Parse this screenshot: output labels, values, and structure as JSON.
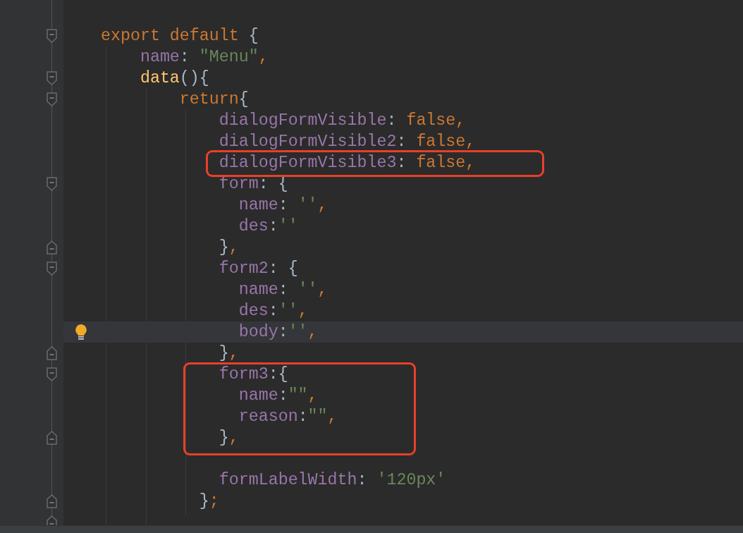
{
  "lines": [
    {
      "kind": "blank",
      "boxed": false
    },
    {
      "kind": "code",
      "boxed": false,
      "gutter": {
        "kind": "fold-start"
      },
      "tokens": [
        {
          "kind": "keyword",
          "text": "export default"
        },
        {
          "kind": "punct",
          "text": " {"
        }
      ]
    },
    {
      "kind": "code",
      "boxed": false,
      "tokens": [
        {
          "kind": "prop",
          "text": "    name"
        },
        {
          "kind": "punct",
          "text": ": "
        },
        {
          "kind": "string",
          "text": "\"Menu\""
        },
        {
          "kind": "keyword",
          "text": ","
        }
      ]
    },
    {
      "kind": "code",
      "boxed": false,
      "gutter": {
        "kind": "fold-start"
      },
      "tokens": [
        {
          "kind": "func",
          "text": "    data"
        },
        {
          "kind": "punct",
          "text": "(){"
        }
      ]
    },
    {
      "kind": "code",
      "boxed": false,
      "gutter": {
        "kind": "fold-start"
      },
      "tokens": [
        {
          "kind": "keyword",
          "text": "        return"
        },
        {
          "kind": "punct",
          "text": "{"
        }
      ]
    },
    {
      "kind": "code",
      "boxed": false,
      "tokens": [
        {
          "kind": "prop",
          "text": "            dialogFormVisible"
        },
        {
          "kind": "punct",
          "text": ": "
        },
        {
          "kind": "keyword",
          "text": "false,"
        }
      ]
    },
    {
      "kind": "code",
      "boxed": false,
      "tokens": [
        {
          "kind": "prop",
          "text": "            dialogFormVisible2"
        },
        {
          "kind": "punct",
          "text": ": "
        },
        {
          "kind": "keyword",
          "text": "false,"
        }
      ]
    },
    {
      "kind": "code",
      "boxed": true,
      "tokens": [
        {
          "kind": "prop",
          "text": "            dialogFormVisible3"
        },
        {
          "kind": "punct",
          "text": ": "
        },
        {
          "kind": "keyword",
          "text": "false,"
        }
      ]
    },
    {
      "kind": "code",
      "boxed": false,
      "gutter": {
        "kind": "fold-start"
      },
      "tokens": [
        {
          "kind": "prop",
          "text": "            form"
        },
        {
          "kind": "punct",
          "text": ": {"
        }
      ]
    },
    {
      "kind": "code",
      "boxed": false,
      "tokens": [
        {
          "kind": "prop",
          "text": "              name"
        },
        {
          "kind": "punct",
          "text": ": "
        },
        {
          "kind": "string",
          "text": "''"
        },
        {
          "kind": "keyword",
          "text": ","
        }
      ]
    },
    {
      "kind": "code",
      "boxed": false,
      "tokens": [
        {
          "kind": "prop",
          "text": "              des"
        },
        {
          "kind": "punct",
          "text": ":"
        },
        {
          "kind": "string",
          "text": "''"
        }
      ]
    },
    {
      "kind": "code",
      "boxed": false,
      "gutter": {
        "kind": "fold-end"
      },
      "tokens": [
        {
          "kind": "punct",
          "text": "            }"
        },
        {
          "kind": "keyword",
          "text": ","
        }
      ]
    },
    {
      "kind": "code",
      "boxed": false,
      "gutter": {
        "kind": "fold-start"
      },
      "tokens": [
        {
          "kind": "prop",
          "text": "            form2"
        },
        {
          "kind": "punct",
          "text": ": {"
        }
      ]
    },
    {
      "kind": "code",
      "boxed": false,
      "tokens": [
        {
          "kind": "prop",
          "text": "              name"
        },
        {
          "kind": "punct",
          "text": ": "
        },
        {
          "kind": "string",
          "text": "''"
        },
        {
          "kind": "keyword",
          "text": ","
        }
      ]
    },
    {
      "kind": "code",
      "boxed": false,
      "tokens": [
        {
          "kind": "prop",
          "text": "              des"
        },
        {
          "kind": "punct",
          "text": ":"
        },
        {
          "kind": "string",
          "text": "''"
        },
        {
          "kind": "keyword",
          "text": ","
        }
      ]
    },
    {
      "kind": "code",
      "boxed": false,
      "current": true,
      "gutter": {
        "kind": "bulb"
      },
      "tokens": [
        {
          "kind": "prop",
          "text": "              body"
        },
        {
          "kind": "punct",
          "text": ":"
        },
        {
          "kind": "string",
          "text": "''"
        },
        {
          "kind": "keyword",
          "text": ","
        }
      ]
    },
    {
      "kind": "code",
      "boxed": false,
      "gutter": {
        "kind": "fold-end"
      },
      "tokens": [
        {
          "kind": "punct",
          "text": "            }"
        },
        {
          "kind": "keyword",
          "text": ","
        }
      ]
    },
    {
      "kind": "code",
      "boxed": true,
      "gutter": {
        "kind": "fold-start"
      },
      "tokens": [
        {
          "kind": "prop",
          "text": "            form3"
        },
        {
          "kind": "punct",
          "text": ":{"
        }
      ]
    },
    {
      "kind": "code",
      "boxed": true,
      "tokens": [
        {
          "kind": "prop",
          "text": "              name"
        },
        {
          "kind": "punct",
          "text": ":"
        },
        {
          "kind": "string",
          "text": "\"\""
        },
        {
          "kind": "keyword",
          "text": ","
        }
      ]
    },
    {
      "kind": "code",
      "boxed": true,
      "tokens": [
        {
          "kind": "prop",
          "text": "              reason"
        },
        {
          "kind": "punct",
          "text": ":"
        },
        {
          "kind": "string",
          "text": "\"\""
        },
        {
          "kind": "keyword",
          "text": ","
        }
      ]
    },
    {
      "kind": "code",
      "boxed": true,
      "gutter": {
        "kind": "fold-end"
      },
      "tokens": [
        {
          "kind": "punct",
          "text": "            }"
        },
        {
          "kind": "keyword",
          "text": ","
        }
      ]
    },
    {
      "kind": "blank",
      "boxed": false
    },
    {
      "kind": "code",
      "boxed": false,
      "tokens": [
        {
          "kind": "prop",
          "text": "            formLabelWidth"
        },
        {
          "kind": "punct",
          "text": ": "
        },
        {
          "kind": "string",
          "text": "'120px'"
        }
      ]
    },
    {
      "kind": "code",
      "boxed": false,
      "gutter": {
        "kind": "fold-end"
      },
      "tokens": [
        {
          "kind": "punct",
          "text": "          }"
        },
        {
          "kind": "keyword",
          "text": ";"
        }
      ]
    },
    {
      "kind": "blank",
      "boxed": false,
      "gutter": {
        "kind": "fold-end"
      }
    }
  ]
}
